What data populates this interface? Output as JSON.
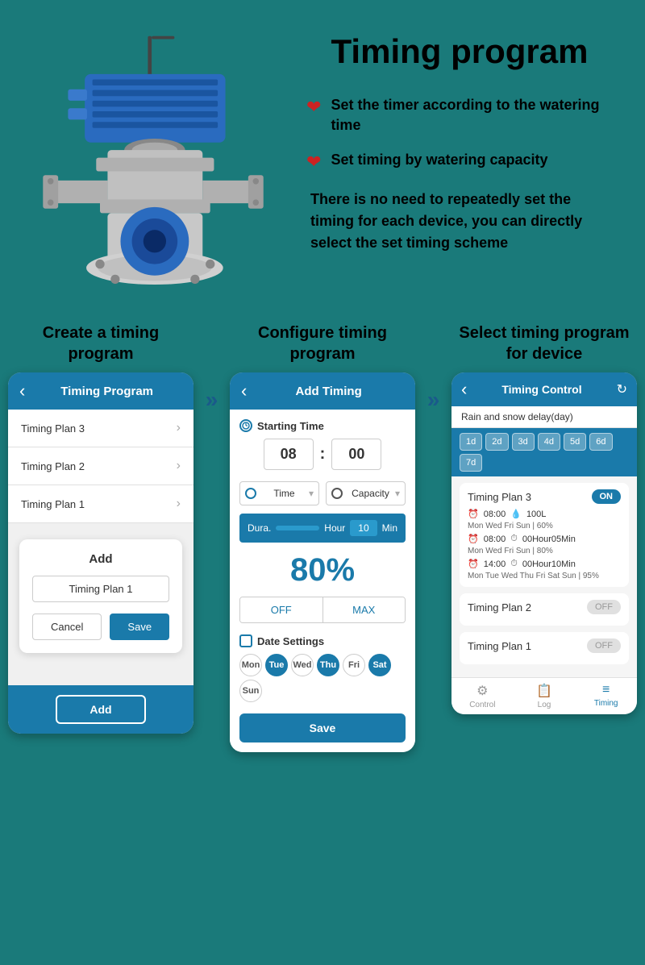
{
  "page": {
    "title": "Timing program",
    "background_color": "#1a7a7a"
  },
  "header": {
    "bullets": [
      {
        "icon": "❤",
        "text": "Set the timer according to the watering time"
      },
      {
        "icon": "❤",
        "text": "Set timing by watering capacity"
      }
    ],
    "description": "There is no need to repeatedly set the timing for each device, you can directly select the set timing scheme"
  },
  "phone1": {
    "label": "Create a timing program",
    "header_title": "Timing Program",
    "back_icon": "‹",
    "items": [
      {
        "name": "Timing Plan 3"
      },
      {
        "name": "Timing Plan 2"
      },
      {
        "name": "Timing Plan 1"
      }
    ],
    "dialog": {
      "title": "Add",
      "placeholder": "Timing Plan 1",
      "cancel": "Cancel",
      "save": "Save"
    },
    "add_button": "Add"
  },
  "phone2": {
    "label": "Configure timing program",
    "header_title": "Add Timing",
    "back_icon": "‹",
    "starting_time_label": "Starting Time",
    "hour": "08",
    "minute": "00",
    "selector1": "Time",
    "selector2": "Capacity",
    "duration_label": "Dura.",
    "hour_label": "Hour",
    "min_value": "10",
    "min_label": "Min",
    "percentage": "80%",
    "off_label": "OFF",
    "max_label": "MAX",
    "date_settings_label": "Date Settings",
    "days": [
      {
        "label": "Mon",
        "active": false
      },
      {
        "label": "Tue",
        "active": true
      },
      {
        "label": "Wed",
        "active": false
      },
      {
        "label": "Thu",
        "active": true
      },
      {
        "label": "Fri",
        "active": false
      },
      {
        "label": "Sat",
        "active": true
      },
      {
        "label": "Sun",
        "active": false
      }
    ],
    "save_button": "Save"
  },
  "phone3": {
    "label": "Select timing program for device",
    "header_title": "Timing Control",
    "back_icon": "‹",
    "rain_label": "Rain and snow delay(day)",
    "day_buttons": [
      "1d",
      "2d",
      "3d",
      "4d",
      "5d",
      "6d",
      "7d"
    ],
    "plans": [
      {
        "name": "Timing Plan 3",
        "toggle": "ON",
        "on": true,
        "entries": [
          {
            "time": "08:00",
            "value": "100L",
            "schedule": "Mon Wed Fri Sun | 60%"
          },
          {
            "time": "08:00",
            "value": "00Hour05Min",
            "schedule": "Mon Wed Fri Sun | 80%"
          },
          {
            "time": "14:00",
            "value": "00Hour10Min",
            "schedule": "Mon Tue Wed Thu Fri Sat Sun | 95%"
          }
        ]
      },
      {
        "name": "Timing Plan 2",
        "toggle": "OFF",
        "on": false,
        "entries": []
      },
      {
        "name": "Timing Plan 1",
        "toggle": "OFF",
        "on": false,
        "entries": []
      }
    ],
    "nav_items": [
      {
        "label": "Control",
        "icon": "⚙"
      },
      {
        "label": "Log",
        "icon": "📋"
      },
      {
        "label": "Timing",
        "icon": "≡",
        "active": true
      }
    ]
  }
}
